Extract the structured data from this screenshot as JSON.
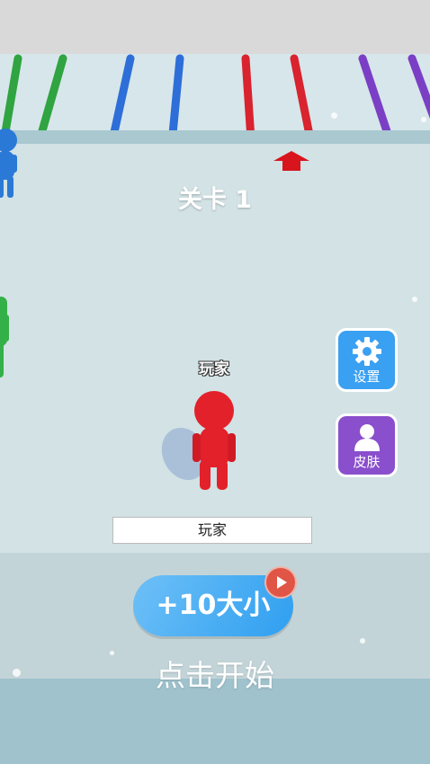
{
  "game": {
    "level_title": "关卡 1",
    "player_tag": "玩家",
    "name_input_value": "玩家",
    "settings_label": "设置",
    "skin_label": "皮肤",
    "size_button_label": "+10大小",
    "start_text": "点击开始"
  },
  "colors": {
    "player": "#e3212a",
    "opponent_blue": "#2a79d6",
    "opponent_green": "#34b048",
    "settings_bg": "#3aa0f2",
    "skin_bg": "#8a4fcc",
    "pole_green": "#2fa441",
    "pole_blue": "#2d6ed8",
    "pole_red": "#d9232f",
    "pole_purple": "#7b3fc6"
  },
  "icons": {
    "settings": "gear-icon",
    "skin": "person-icon",
    "video": "play-icon",
    "direction": "arrow-up-icon"
  }
}
